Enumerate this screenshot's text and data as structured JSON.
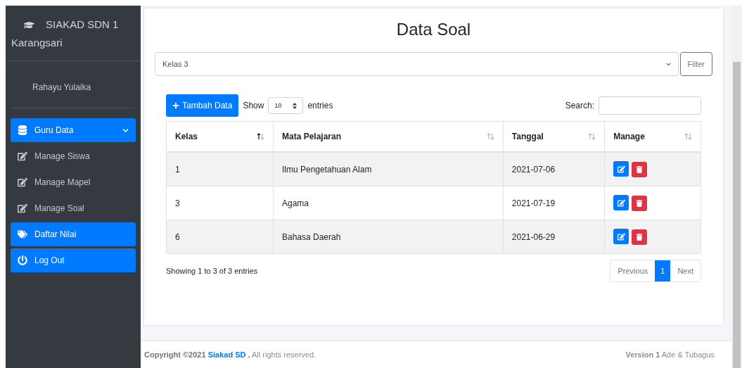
{
  "sidebar": {
    "brand": [
      "SIAKAD SDN 1",
      "Karangsari"
    ],
    "user": "Rahayu Yulaika",
    "items": [
      {
        "label": "Guru Data",
        "kind": "group",
        "expanded": true
      },
      {
        "label": "Manage Siswa",
        "kind": "sub"
      },
      {
        "label": "Manage Mapel",
        "kind": "sub"
      },
      {
        "label": "Manage Soal",
        "kind": "sub"
      },
      {
        "label": "Daftar Nilai",
        "kind": "main"
      },
      {
        "label": "Log Out",
        "kind": "main"
      }
    ]
  },
  "card": {
    "title": "Data Soal",
    "filter": {
      "value": "Kelas 3",
      "button": "Filter"
    },
    "add_button": "Tambah Data",
    "length": {
      "before": "Show",
      "value": "10",
      "after": "entries"
    },
    "search_label": "Search:",
    "table": {
      "columns": [
        {
          "label": "Kelas",
          "sorted": true
        },
        {
          "label": "Mata Pelajaran",
          "sorted": false
        },
        {
          "label": "Tanggal",
          "sorted": false
        },
        {
          "label": "Manage",
          "sorted": false
        }
      ],
      "rows": [
        [
          "1",
          "Ilmu Pengetahuan Alam",
          "2021-07-06"
        ],
        [
          "3",
          "Agama",
          "2021-07-19"
        ],
        [
          "6",
          "Bahasa Daerah",
          "2021-06-29"
        ]
      ]
    },
    "info": "Showing 1 to 3 of 3 entries",
    "pagination": [
      {
        "label": "Previous",
        "kind": "nav",
        "selected": false
      },
      {
        "label": "1",
        "kind": "page",
        "selected": true
      },
      {
        "label": "Next",
        "kind": "nav",
        "selected": false
      }
    ]
  },
  "footer": {
    "prefix": "Copyright ©2021",
    "link": "Siakad SD .",
    "suffix": "All rights reserved.",
    "version": "**Version 1** Ade & Tubagus"
  }
}
